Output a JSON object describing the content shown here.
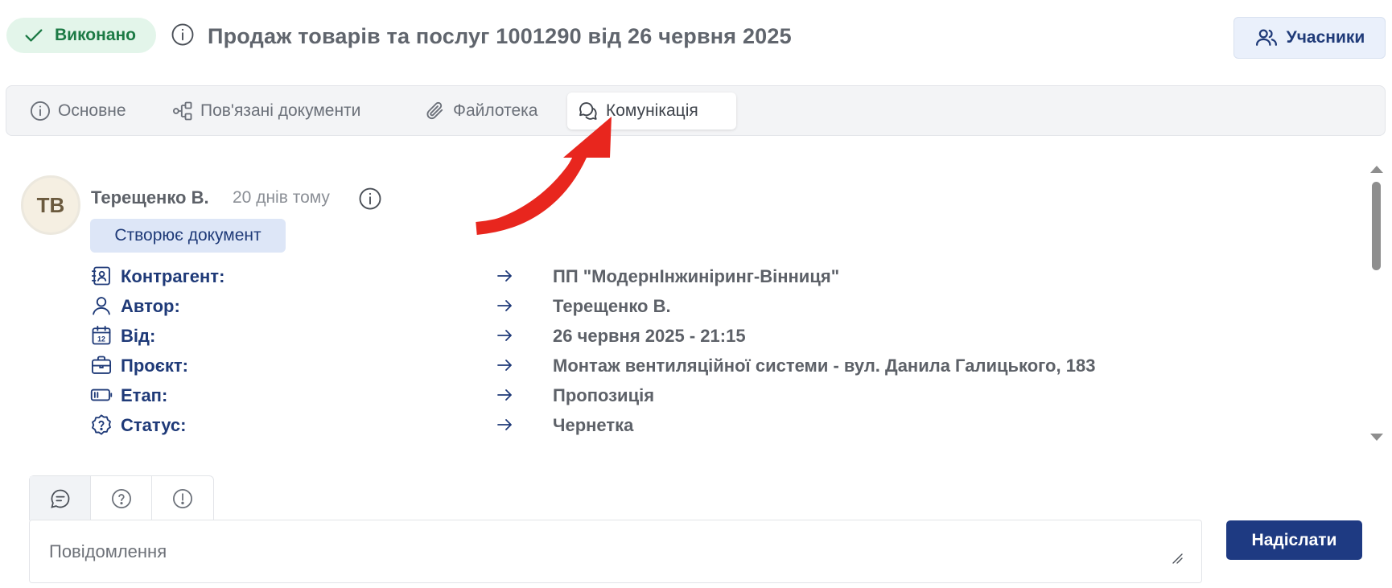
{
  "header": {
    "status_label": "Виконано",
    "status_color": "#1c7a45",
    "title": "Продаж товарів та послуг 1001290 від 26 червня 2025",
    "participants_label": "Учасники"
  },
  "tabs": [
    {
      "label": "Основне",
      "icon": "info-icon",
      "active": false
    },
    {
      "label": "Пов'язані документи",
      "icon": "related-docs-icon",
      "active": false
    },
    {
      "label": "Файлотека",
      "icon": "paperclip-icon",
      "active": false
    },
    {
      "label": "Комунікація",
      "icon": "chat-bubbles-icon",
      "active": true
    }
  ],
  "message": {
    "avatar_initials": "ТВ",
    "author": "Терещенко В.",
    "time_ago": "20 днів тому",
    "action": "Створює документ",
    "details": [
      {
        "icon": "contact-card-icon",
        "label": "Контрагент:",
        "value": "ПП \"МодернІнжиніринг-Вінниця\""
      },
      {
        "icon": "user-icon",
        "label": "Автор:",
        "value": "Терещенко В."
      },
      {
        "icon": "calendar-icon",
        "label": "Від:",
        "value": "26 червня 2025 - 21:15"
      },
      {
        "icon": "briefcase-icon",
        "label": "Проєкт:",
        "value": "Монтаж вентиляційної системи - вул. Данила Галицького, 183"
      },
      {
        "icon": "battery-icon",
        "label": "Етап:",
        "value": "Пропозиція"
      },
      {
        "icon": "question-badge-icon",
        "label": "Статус:",
        "value": "Чернетка"
      }
    ]
  },
  "composer": {
    "types": [
      "comment-icon",
      "question-icon",
      "warning-icon"
    ],
    "placeholder": "Повідомлення",
    "send_label": "Надіслати"
  },
  "colors": {
    "accent": "#1e3a82",
    "annotation_arrow": "#e8261e"
  }
}
